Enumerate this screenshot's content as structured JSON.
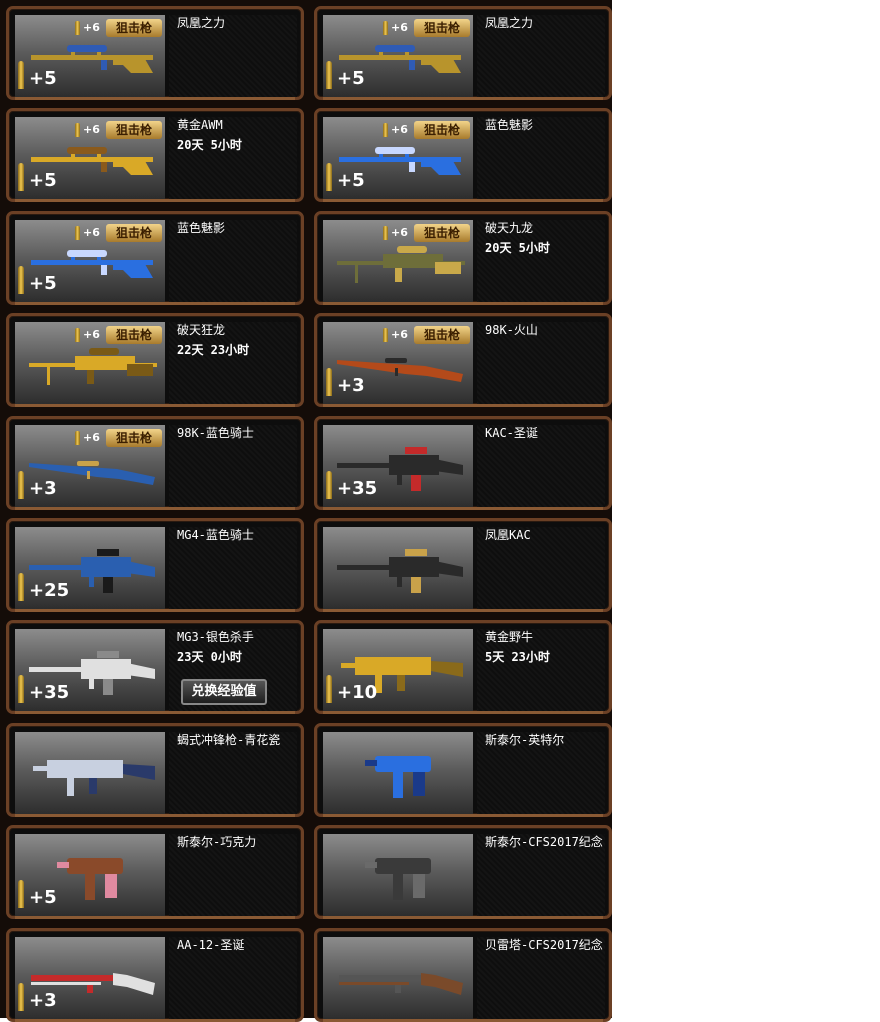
{
  "sniper_tag": "狙击枪",
  "plus6_label": "+6",
  "exchange_label": "兑换经验值",
  "items": [
    {
      "name": "凤凰之力",
      "time": "",
      "bonus": "+5",
      "sniper": true,
      "weapon": "sniper",
      "colors": [
        "#b8942c",
        "#2f5bb5"
      ]
    },
    {
      "name": "凤凰之力",
      "time": "",
      "bonus": "+5",
      "sniper": true,
      "weapon": "sniper",
      "colors": [
        "#b8942c",
        "#2f5bb5"
      ]
    },
    {
      "name": "黄金AWM",
      "time": "20天 5小时",
      "bonus": "+5",
      "sniper": true,
      "weapon": "sniper",
      "colors": [
        "#d9a927",
        "#8a5a1c"
      ]
    },
    {
      "name": "蓝色魅影",
      "time": "",
      "bonus": "+5",
      "sniper": true,
      "weapon": "sniper",
      "colors": [
        "#2a6fe0",
        "#c8d8ff"
      ]
    },
    {
      "name": "蓝色魅影",
      "time": "",
      "bonus": "+5",
      "sniper": true,
      "weapon": "sniper",
      "colors": [
        "#2a6fe0",
        "#c8d8ff"
      ]
    },
    {
      "name": "破天九龙",
      "time": "20天 5小时",
      "bonus": "",
      "sniper": true,
      "weapon": "heavy",
      "colors": [
        "#6e6e3a",
        "#c9a94a"
      ]
    },
    {
      "name": "破天狂龙",
      "time": "22天 23小时",
      "bonus": "",
      "sniper": true,
      "weapon": "heavy",
      "colors": [
        "#d9a927",
        "#7a5a16"
      ]
    },
    {
      "name": "98K-火山",
      "time": "",
      "bonus": "+3",
      "sniper": true,
      "weapon": "rifle",
      "colors": [
        "#b44a1a",
        "#2a2a2a"
      ]
    },
    {
      "name": "98K-蓝色骑士",
      "time": "",
      "bonus": "+3",
      "sniper": true,
      "weapon": "rifle",
      "colors": [
        "#2a5fb0",
        "#c9a24a"
      ]
    },
    {
      "name": "KAC-圣诞",
      "time": "",
      "bonus": "+35",
      "sniper": false,
      "weapon": "mg",
      "colors": [
        "#2a2a2a",
        "#c42a2a"
      ]
    },
    {
      "name": "MG4-蓝色骑士",
      "time": "",
      "bonus": "+25",
      "sniper": false,
      "weapon": "mg",
      "colors": [
        "#2a5fb0",
        "#1a1a1a"
      ]
    },
    {
      "name": "凤凰KAC",
      "time": "",
      "bonus": "",
      "sniper": false,
      "weapon": "mg",
      "colors": [
        "#2a2a2a",
        "#c9a24a"
      ]
    },
    {
      "name": "MG3-银色杀手",
      "time": "23天 0小时",
      "bonus": "+35",
      "sniper": false,
      "weapon": "mg",
      "colors": [
        "#e0e0e0",
        "#8a8a8a"
      ],
      "exchange": true
    },
    {
      "name": "黄金野牛",
      "time": "5天 23小时",
      "bonus": "+10",
      "sniper": false,
      "weapon": "smg",
      "colors": [
        "#d9a927",
        "#8a6a1a"
      ]
    },
    {
      "name": "蝎式冲锋枪-青花瓷",
      "time": "",
      "bonus": "",
      "sniper": false,
      "weapon": "smg",
      "colors": [
        "#c8d0e0",
        "#2a3a6a"
      ]
    },
    {
      "name": "斯泰尔-英特尔",
      "time": "",
      "bonus": "",
      "sniper": false,
      "weapon": "pistol",
      "colors": [
        "#2a6fe0",
        "#1a3a8a"
      ]
    },
    {
      "name": "斯泰尔-巧克力",
      "time": "",
      "bonus": "+5",
      "sniper": false,
      "weapon": "pistol",
      "colors": [
        "#8a4a2a",
        "#e08aa0"
      ]
    },
    {
      "name": "斯泰尔-CFS2017纪念",
      "time": "",
      "bonus": "",
      "sniper": false,
      "weapon": "pistol",
      "colors": [
        "#3a3a3a",
        "#6a6a6a"
      ]
    },
    {
      "name": "AA-12-圣诞",
      "time": "",
      "bonus": "+3",
      "sniper": false,
      "weapon": "shotgun",
      "colors": [
        "#c42a2a",
        "#e0e0e0"
      ]
    },
    {
      "name": "贝雷塔-CFS2017纪念",
      "time": "",
      "bonus": "",
      "sniper": false,
      "weapon": "shotgun",
      "colors": [
        "#555555",
        "#7a4a2a"
      ]
    }
  ]
}
